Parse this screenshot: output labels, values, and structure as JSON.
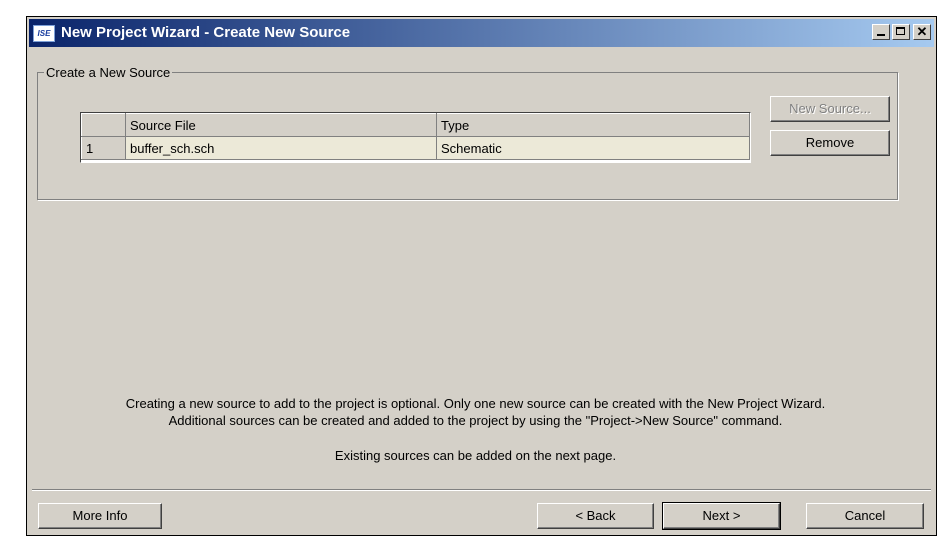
{
  "window": {
    "title": "New Project Wizard - Create New Source",
    "icon": "ISE",
    "icon_name": "ise-app-icon"
  },
  "group": {
    "label": "Create a New Source"
  },
  "table": {
    "columns": [
      "",
      "Source File",
      "Type"
    ],
    "rows": [
      {
        "num": "1",
        "file": "buffer_sch.sch",
        "type": "Schematic"
      }
    ]
  },
  "buttons": {
    "new_source": "New Source...",
    "remove": "Remove",
    "more_info": "More Info",
    "back": "< Back",
    "next": "Next >",
    "cancel": "Cancel"
  },
  "info": {
    "line1": "Creating a new source to add to the project is optional. Only one new source can be created with the New Project Wizard.",
    "line2": "Additional sources can be created and added to the project by using the \"Project->New Source\" command.",
    "line3": "Existing sources can be added on the next page."
  }
}
